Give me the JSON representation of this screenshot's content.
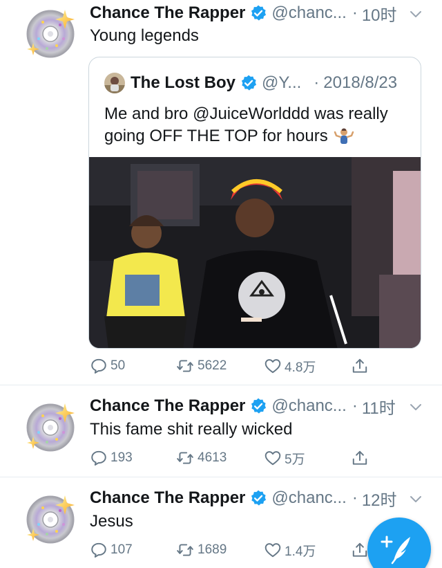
{
  "colors": {
    "accent": "#1da1f2",
    "text": "#14171a",
    "muted": "#657786",
    "border": "#ccd6dd"
  },
  "tweets": [
    {
      "author_name": "Chance The Rapper",
      "handle": "@chanc...",
      "separator": "·",
      "time": "10时",
      "text": "Young legends",
      "avatar_icon": "cd-disc-sparkle-icon",
      "quote": {
        "author_name": "The Lost Boy",
        "handle": "@Y...",
        "separator": "·",
        "date": "2018/8/23",
        "text_line1": "Me and bro @JuiceWorlddd was really",
        "text_line2": "going OFF THE TOP for hours",
        "emoji_name": "person-shrugging-icon",
        "media_description_icon": "video-thumbnail-icon"
      },
      "replies": "50",
      "retweets": "5622",
      "likes": "4.8万"
    },
    {
      "author_name": "Chance The Rapper",
      "handle": "@chanc...",
      "separator": "·",
      "time": "11时",
      "text": "This fame shit really wicked",
      "avatar_icon": "cd-disc-sparkle-icon",
      "replies": "193",
      "retweets": "4613",
      "likes": "5万"
    },
    {
      "author_name": "Chance The Rapper",
      "handle": "@chanc...",
      "separator": "·",
      "time": "12时",
      "text": "Jesus",
      "avatar_icon": "cd-disc-sparkle-icon",
      "replies": "107",
      "retweets": "1689",
      "likes": "1.4万"
    }
  ],
  "compose_button_icon": "compose-feather-icon"
}
